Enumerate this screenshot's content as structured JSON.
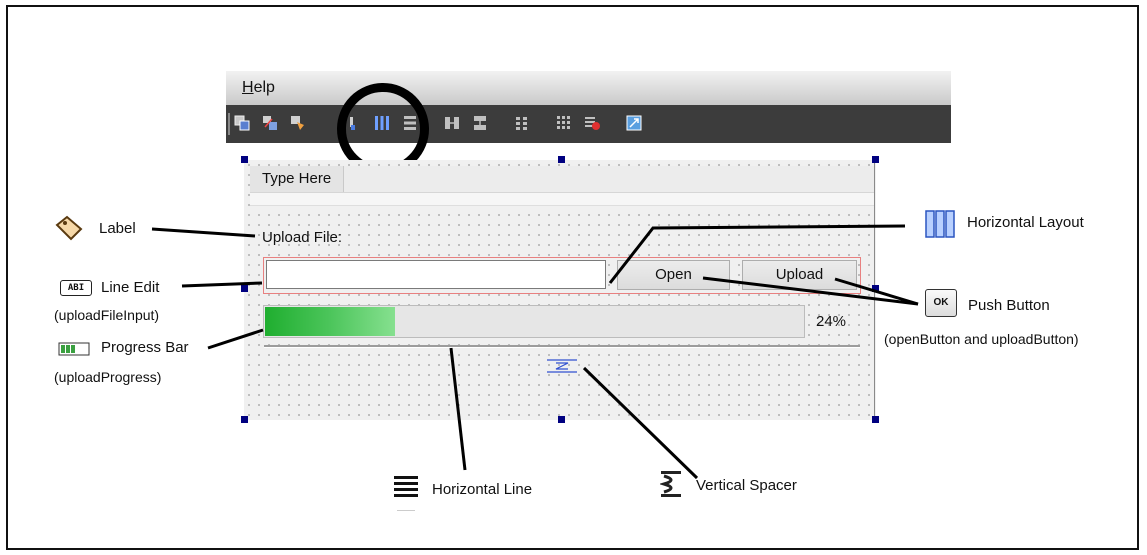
{
  "designer": {
    "menu": {
      "help_label": "Help"
    },
    "toolbar": {
      "icons": [
        "edit-widgets-icon",
        "edit-signals-icon",
        "edit-buddies-icon",
        "edit-tab-order-icon",
        "lay-out-horizontally-icon",
        "lay-out-vertically-icon",
        "lay-out-splitter-horizontal-icon",
        "lay-out-splitter-vertical-icon",
        "lay-out-form-icon",
        "lay-out-grid-icon",
        "break-layout-icon",
        "adjust-size-icon"
      ]
    }
  },
  "form": {
    "menubar_placeholder": "Type Here",
    "upload_label": "Upload File:",
    "upload_input_value": "",
    "open_button_label": "Open",
    "upload_button_label": "Upload",
    "progress_value": 24,
    "progress_text": "24%"
  },
  "annotations": {
    "label": "Label",
    "line_edit": "Line Edit",
    "line_edit_object": "(uploadFileInput)",
    "progress_bar": "Progress Bar",
    "progress_bar_object": "(uploadProgress)",
    "horizontal_layout": "Horizontal Layout",
    "push_button": "Push Button",
    "push_button_objects": "(openButton and uploadButton)",
    "horizontal_line": "Horizontal Line",
    "vertical_spacer": "Vertical Spacer",
    "line_edit_icon_text": "ABI",
    "push_button_icon_text": "OK"
  },
  "colors": {
    "toolbar_bg": "#3c3c3c",
    "selection_handle": "#000080",
    "layout_border": "#e88080",
    "progress_fill": "#1fae2f",
    "layout_icon_blue": "#3a6fd8"
  }
}
